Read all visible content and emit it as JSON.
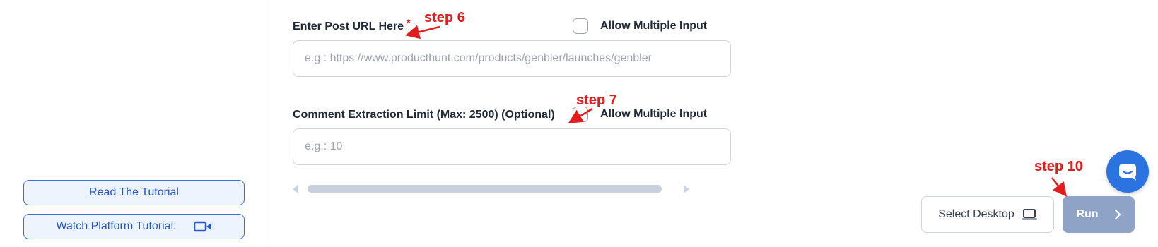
{
  "sidebar": {
    "read_tutorial_label": "Read The Tutorial",
    "watch_tutorial_label": "Watch Platform Tutorial:"
  },
  "form": {
    "post_url": {
      "label": "Enter Post URL Here",
      "required_marker": "*",
      "placeholder": "e.g.: https://www.producthunt.com/products/genbler/launches/genbler",
      "value": "",
      "allow_multiple_label": "Allow Multiple Input"
    },
    "comment_limit": {
      "label": "Comment Extraction Limit (Max: 2500) (Optional)",
      "placeholder": "e.g.: 10",
      "value": "",
      "allow_multiple_label": "Allow Multiple Input"
    }
  },
  "footer": {
    "select_desktop_label": "Select Desktop",
    "run_label": "Run"
  },
  "annotations": {
    "step6": "step 6",
    "step7": "step 7",
    "step10": "step 10",
    "color": "#e11d1d"
  },
  "colors": {
    "accent": "#2b73e0",
    "run_button": "#8fa3c7",
    "tutorial_button_border": "#3b6fd8"
  },
  "icons": [
    "video-camera-icon",
    "laptop-icon",
    "chevron-right-icon",
    "chat-bubble-icon"
  ]
}
